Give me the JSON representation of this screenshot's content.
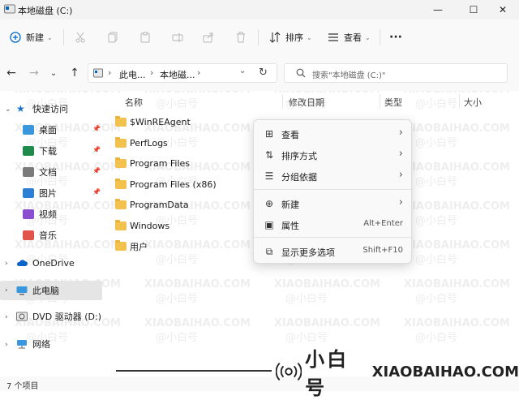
{
  "window": {
    "title": "本地磁盘 (C:)",
    "minimize_glyph": "—",
    "maximize_glyph": "☐",
    "close_glyph": "✕"
  },
  "toolbar": {
    "new_label": "新建",
    "sort_label": "排序",
    "view_label": "查看",
    "more_glyph": "···"
  },
  "address": {
    "path": [
      "此电...",
      "本地磁..."
    ],
    "search_placeholder": "搜索\"本地磁盘 (C:)\""
  },
  "sidebar": {
    "quick_access": "快速访问",
    "items": [
      {
        "label": "桌面",
        "icon": "desktop-icon",
        "pinned": true
      },
      {
        "label": "下载",
        "icon": "download-icon",
        "pinned": true
      },
      {
        "label": "文档",
        "icon": "document-icon",
        "pinned": true
      },
      {
        "label": "图片",
        "icon": "picture-icon",
        "pinned": true
      },
      {
        "label": "视频",
        "icon": "video-icon",
        "pinned": false
      },
      {
        "label": "音乐",
        "icon": "music-icon",
        "pinned": false
      }
    ],
    "onedrive": "OneDrive",
    "this_pc": "此电脑",
    "dvd": "DVD 驱动器 (D:) CI",
    "network": "网络"
  },
  "columns": {
    "name": "名称",
    "modified": "修改日期",
    "type": "类型",
    "size": "大小"
  },
  "files": [
    "$WinREAgent",
    "PerfLogs",
    "Program Files",
    "Program Files (x86)",
    "ProgramData",
    "Windows",
    "用户"
  ],
  "context_menu": {
    "items": [
      {
        "label": "查看",
        "icon": "grid-view-icon",
        "submenu": true
      },
      {
        "label": "排序方式",
        "icon": "sort-icon",
        "submenu": true
      },
      {
        "label": "分组依据",
        "icon": "group-by-icon",
        "submenu": true
      },
      {
        "label": "新建",
        "icon": "new-plus-icon",
        "submenu": true
      },
      {
        "label": "属性",
        "icon": "properties-icon",
        "shortcut": "Alt+Enter"
      },
      {
        "label": "显示更多选项",
        "icon": "more-options-icon",
        "shortcut": "Shift+F10"
      }
    ]
  },
  "status": {
    "item_count": "7 个项目"
  },
  "watermark": {
    "brand_cn": "小白号",
    "brand_en": "XIAOBAIHAO.COM",
    "tile_cn": "@小白号",
    "tile_en": "XIAOBAIHAO.COM"
  },
  "colors": {
    "folder": "#f2c14e",
    "accent": "#0067c0",
    "selection": "#e5e5e5"
  }
}
